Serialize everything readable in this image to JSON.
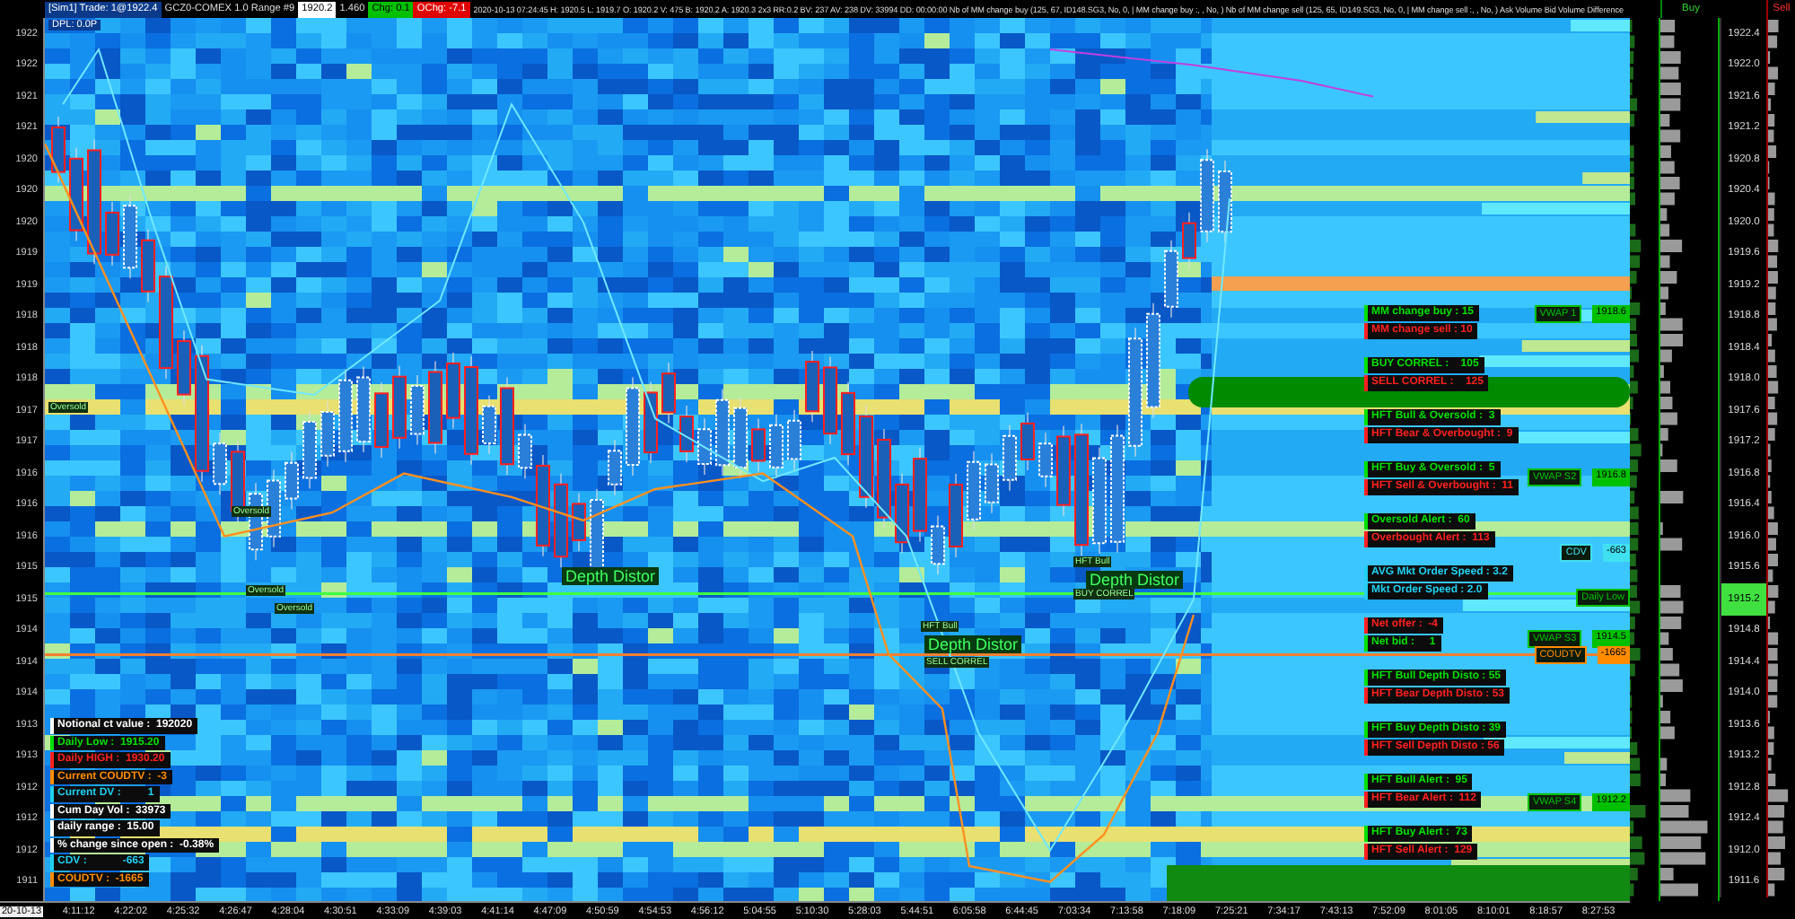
{
  "toolbar": {
    "segments": [
      {
        "text": "[Sim1] Trade: 1@1922.4",
        "kind": "account"
      },
      {
        "text": "GCZ0-COMEX 1.0 Range #9",
        "kind": "plain"
      },
      {
        "text": "1920.2",
        "kind": "price"
      },
      {
        "text": "1.460",
        "kind": "plain"
      },
      {
        "text": "Chg: 0.1",
        "kind": "up"
      },
      {
        "text": "OChg: -7.1",
        "kind": "down"
      },
      {
        "text": "2020-10-13 07:24:45 H: 1920.5 L: 1919.7 O: 1920.2 V: 475 B: 1920.2 A: 1920.3 2x3 RR:0.2 BV: 237 AV: 238 DV: 33994 DD: 00:00:00 Nb of MM change buy (125, 67, ID148.SG3, No, 0, | MM change buy :, , No, ) Nb of MM change sell (125, 65, ID149.SG3, No, 0, | MM change sell :, , No, ) Ask Volume Bid Volume Difference",
        "kind": "plain"
      }
    ]
  },
  "price_axis": {
    "labels": [
      "1922",
      "1922",
      "1921",
      "1921",
      "1920",
      "1920",
      "1920",
      "1919",
      "1919",
      "1918",
      "1918",
      "1918",
      "1917",
      "1917",
      "1916",
      "1916",
      "1916",
      "1915",
      "1915",
      "1914",
      "1914",
      "1914",
      "1913",
      "1913",
      "1912",
      "1912",
      "1912",
      "1911"
    ]
  },
  "chart": {
    "dpl": "DPL: 0.0P",
    "annotations": [
      {
        "text": "Depth Distor",
        "kind": "large"
      },
      {
        "text": "HFT Bull",
        "kind": "small"
      },
      {
        "text": "Depth Distor",
        "kind": "large"
      },
      {
        "text": "BUY CORREL",
        "kind": "small"
      },
      {
        "text": "HFT Bull",
        "kind": "small"
      },
      {
        "text": "Depth Distor",
        "kind": "large"
      },
      {
        "text": "SELL CORREL",
        "kind": "small"
      },
      {
        "text": "Oversold",
        "kind": "small"
      },
      {
        "text": "Oversold",
        "kind": "small"
      },
      {
        "text": "Oversold",
        "kind": "small"
      },
      {
        "text": "Oversold",
        "kind": "small"
      }
    ],
    "left_panel": [
      {
        "text": "Notional ct value :  192020",
        "color": "#ffffff"
      },
      {
        "text": "Daily Low :  1915.20",
        "color": "#00e000"
      },
      {
        "text": "Daily HIGH :  1930.20",
        "color": "#ff2020"
      },
      {
        "text": "Current COUDTV :  -3",
        "color": "#ff8c00"
      },
      {
        "text": "Current DV :         1",
        "color": "#20d0f0"
      },
      {
        "text": "Cum Day Vol :  33973",
        "color": "#ffffff"
      },
      {
        "text": "daily range :  15.00",
        "color": "#ffffff"
      },
      {
        "text": "% change since open :  -0.38%",
        "color": "#ffffff"
      },
      {
        "text": "CDV :            -663",
        "color": "#20d0f0"
      },
      {
        "text": "COUDTV :  -1665",
        "color": "#ff8c00"
      }
    ],
    "right_panel": [
      [
        {
          "text": "MM change buy : 15",
          "color": "#00e000"
        },
        {
          "text": "MM change sell : 10",
          "color": "#ff2020"
        }
      ],
      [
        {
          "text": "BUY CORREL :    105",
          "color": "#00e000"
        },
        {
          "text": "SELL CORREL :    125",
          "color": "#ff2020"
        }
      ],
      [
        {
          "text": "HFT Bull & Oversold :  3",
          "color": "#00e000"
        },
        {
          "text": "HFT Bear & Overbought :  9",
          "color": "#ff2020"
        }
      ],
      [
        {
          "text": "HFT Buy & Oversold :  5",
          "color": "#00e000"
        },
        {
          "text": "HFT Sell & Overbought :  11",
          "color": "#ff2020"
        }
      ],
      [
        {
          "text": "Oversold Alert :  60",
          "color": "#00e000"
        },
        {
          "text": "Overbought Alert :  113",
          "color": "#ff2020"
        }
      ],
      [
        {
          "text": "AVG Mkt Order Speed : 3.2",
          "color": "#20d0f0"
        },
        {
          "text": "Mkt Order Speed : 2.0",
          "color": "#20d0f0"
        }
      ],
      [
        {
          "text": "Net offer :  -4",
          "color": "#ff2020"
        },
        {
          "text": "Net bid :     1",
          "color": "#00e000"
        }
      ],
      [
        {
          "text": "HFT Bull Depth Disto : 55",
          "color": "#00e000"
        },
        {
          "text": "HFT Bear Depth Disto : 53",
          "color": "#ff2020"
        }
      ],
      [
        {
          "text": "HFT Buy Depth Disto : 39",
          "color": "#00e000"
        },
        {
          "text": "HFT Sell Depth Disto : 56",
          "color": "#ff2020"
        }
      ],
      [
        {
          "text": "HFT Bull Alert :  95",
          "color": "#00e000"
        },
        {
          "text": "HFT Bear Alert :  112",
          "color": "#ff2020"
        }
      ],
      [
        {
          "text": "HFT Buy Alert :  73",
          "color": "#00e000"
        },
        {
          "text": "HFT Sell Alert :  129",
          "color": "#ff2020"
        }
      ]
    ],
    "tags": [
      {
        "label": "VWAP 1",
        "value": "1918.6",
        "color": "#00c000"
      },
      {
        "label": "VWAP S2",
        "value": "1916.8",
        "color": "#00c000"
      },
      {
        "label": "CDV",
        "value": "-663",
        "color": "#40e0f0"
      },
      {
        "label": "Daily Low",
        "color": "#00c000"
      },
      {
        "label": "VWAP S3",
        "value": "1914.5",
        "color": "#00c000"
      },
      {
        "label": "COUDTV",
        "value": "-1665",
        "color": "#ff8c00"
      },
      {
        "label": "VWAP S4",
        "value": "1912.2",
        "color": "#00c000"
      }
    ]
  },
  "ladder": {
    "buy_header": "Buy",
    "sell_header": "Sell",
    "prices": [
      {
        "price": "1922.4",
        "highlight": false
      },
      {
        "price": "1922.0",
        "highlight": false
      },
      {
        "price": "1921.6",
        "highlight": false
      },
      {
        "price": "1921.2",
        "highlight": false
      },
      {
        "price": "1920.8",
        "highlight": false
      },
      {
        "price": "1920.4",
        "highlight": false
      },
      {
        "price": "1920.0",
        "highlight": false
      },
      {
        "price": "1919.6",
        "highlight": false
      },
      {
        "price": "1919.2",
        "highlight": false
      },
      {
        "price": "1918.8",
        "highlight": false
      },
      {
        "price": "1918.4",
        "highlight": false
      },
      {
        "price": "1918.0",
        "highlight": false
      },
      {
        "price": "1917.6",
        "highlight": false
      },
      {
        "price": "1917.2",
        "highlight": false
      },
      {
        "price": "1916.8",
        "highlight": false
      },
      {
        "price": "1916.4",
        "highlight": false
      },
      {
        "price": "1916.0",
        "highlight": false
      },
      {
        "price": "1915.6",
        "highlight": false
      },
      {
        "price": "1915.2",
        "highlight": true
      },
      {
        "price": "1914.8",
        "highlight": false
      },
      {
        "price": "1914.4",
        "highlight": false
      },
      {
        "price": "1914.0",
        "highlight": false
      },
      {
        "price": "1913.6",
        "highlight": false
      },
      {
        "price": "1913.2",
        "highlight": false
      },
      {
        "price": "1912.8",
        "highlight": false
      },
      {
        "price": "1912.4",
        "highlight": false
      },
      {
        "price": "1912.0",
        "highlight": false
      },
      {
        "price": "1911.6",
        "highlight": false
      }
    ]
  },
  "time_axis": {
    "date": "20-10-13",
    "times": [
      "4:11:12",
      "4:22:02",
      "4:25:32",
      "4:26:47",
      "4:28:04",
      "4:30:51",
      "4:33:09",
      "4:39:03",
      "4:41:14",
      "4:47:09",
      "4:50:59",
      "4:54:53",
      "4:56:12",
      "5:04:55",
      "5:10:30",
      "5:28:03",
      "5:44:51",
      "6:05:58",
      "6:44:45",
      "7:03:34",
      "7:13:58",
      "7:18:09",
      "7:25:21",
      "7:34:17",
      "7:43:13",
      "7:52:09",
      "8:01:05",
      "8:10:01",
      "8:18:57",
      "8:27:53"
    ]
  }
}
